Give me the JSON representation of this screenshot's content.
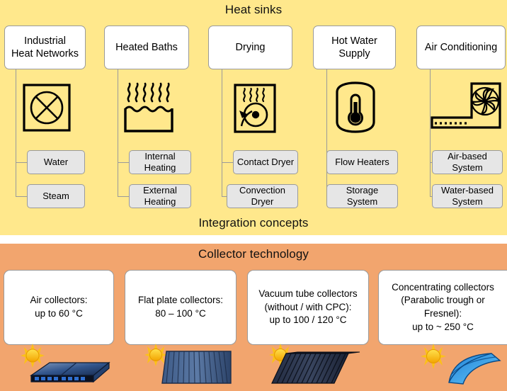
{
  "sections": {
    "heat_sinks_title": "Heat sinks",
    "integration_title": "Integration concepts",
    "collector_title": "Collector technology"
  },
  "colors": {
    "heat_band": "#ffe88c",
    "collector_band": "#f2a56e",
    "card_bg": "#ffffff",
    "subbox_bg": "#e6e6e6",
    "line": "#9a9a9a",
    "text": "#000000"
  },
  "heat_sinks": [
    {
      "title": "Industrial\nHeat Networks",
      "title_line1": "Industrial",
      "title_line2": "Heat Networks",
      "icon": "heat-exchanger-icon",
      "subitems": [
        {
          "label": "Water"
        },
        {
          "label": "Steam"
        }
      ]
    },
    {
      "title": "Heated Baths",
      "title_line1": "Heated Baths",
      "title_line2": "",
      "icon": "heated-bath-icon",
      "subitems": [
        {
          "label_line1": "Internal",
          "label_line2": "Heating"
        },
        {
          "label_line1": "External",
          "label_line2": "Heating"
        }
      ]
    },
    {
      "title": "Drying",
      "title_line1": "Drying",
      "title_line2": "",
      "icon": "dryer-drum-icon",
      "subitems": [
        {
          "label_line1": "Contact Dryer",
          "label_line2": ""
        },
        {
          "label_line1": "Convection",
          "label_line2": "Dryer"
        }
      ]
    },
    {
      "title": "Hot Water Supply",
      "title_line1": "Hot Water",
      "title_line2": "Supply",
      "icon": "water-tank-thermometer-icon",
      "subitems": [
        {
          "label_line1": "Flow Heaters",
          "label_line2": ""
        },
        {
          "label_line1": "Storage",
          "label_line2": "System"
        }
      ]
    },
    {
      "title": "Air Conditioning",
      "title_line1": "Air Conditioning",
      "title_line2": "",
      "icon": "air-conditioning-fan-icon",
      "subitems": [
        {
          "label_line1": "Air-based",
          "label_line2": "System"
        },
        {
          "label_line1": "Water-based",
          "label_line2": "System"
        }
      ]
    }
  ],
  "collectors": [
    {
      "line1": "Air collectors:",
      "line2": "up to 60 °C",
      "line3": "",
      "line4": "",
      "illustration": "air-collector-illustration"
    },
    {
      "line1": "Flat plate collectors:",
      "line2": "80 – 100 °C",
      "line3": "",
      "line4": "",
      "illustration": "flat-plate-collector-illustration"
    },
    {
      "line1": "Vacuum tube collectors",
      "line2": "(without / with CPC):",
      "line3": "up to 100 / 120 °C",
      "line4": "",
      "illustration": "vacuum-tube-collector-illustration"
    },
    {
      "line1": "Concentrating collectors",
      "line2": "(Parabolic trough or",
      "line3": "Fresnel):",
      "line4": "up to ~ 250 °C",
      "illustration": "concentrating-collector-illustration"
    }
  ]
}
